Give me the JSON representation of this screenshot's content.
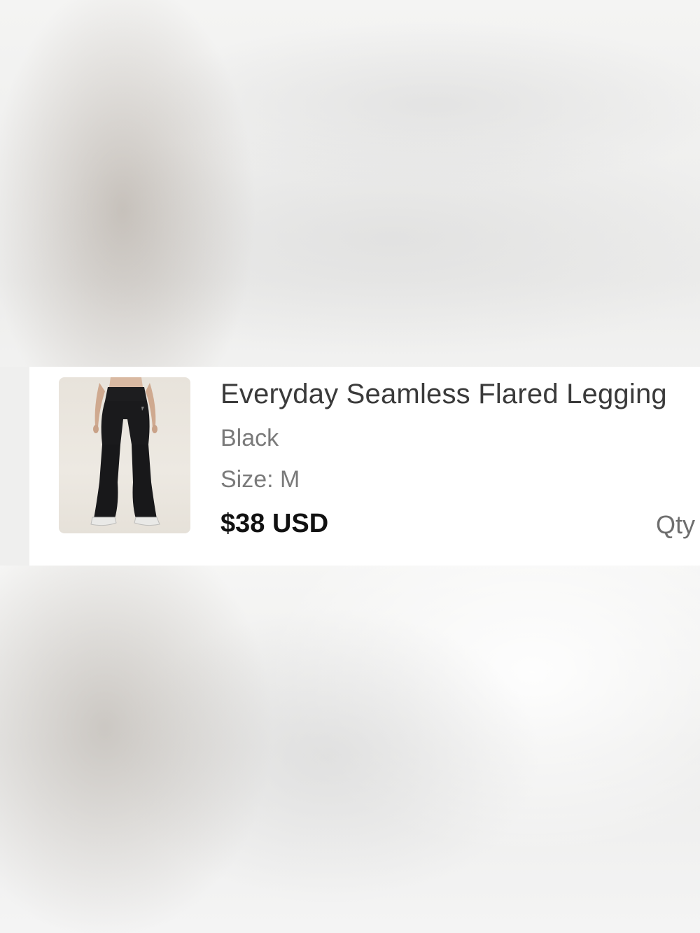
{
  "cart_item": {
    "title": "Everyday Seamless Flared Legging",
    "color": "Black",
    "size": "Size: M",
    "price": "$38 USD",
    "qty_label": "Qty",
    "image_alt": "product-photo-leggings"
  }
}
